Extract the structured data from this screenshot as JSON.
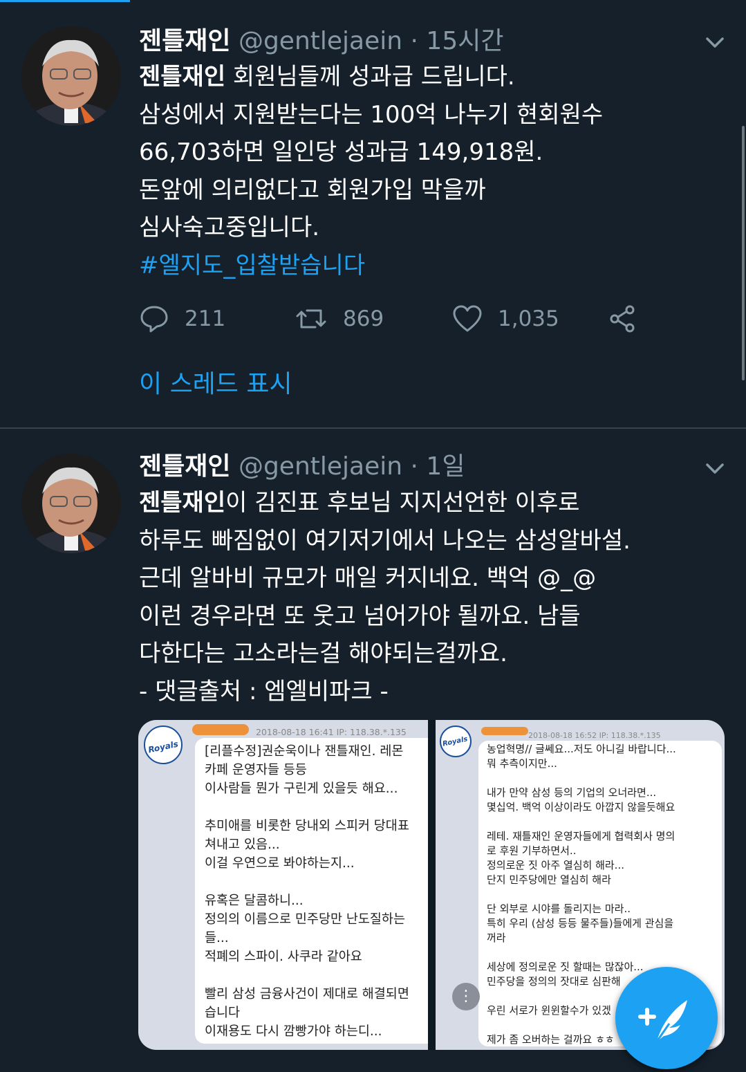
{
  "colors": {
    "background": "#15202b",
    "accent": "#1da1f2",
    "secondary_text": "#8899a6",
    "divider": "#38444d"
  },
  "tweets": [
    {
      "name": "젠틀재인",
      "handle": "@gentlejaein",
      "separator": "·",
      "time": "15시간",
      "lines": [
        {
          "bold": "젠틀재인",
          "rest": " 회원님들께 성과급 드립니다."
        },
        {
          "bold": "",
          "rest": "삼성에서 지원받는다는 100억 나누기 현회원수"
        },
        {
          "bold": "",
          "rest": "66,703하면 일인당 성과급 149,918원."
        },
        {
          "bold": "",
          "rest": "돈앞에 의리없다고 회원가입 막을까"
        },
        {
          "bold": "",
          "rest": "심사숙고중입니다."
        }
      ],
      "hashtag": "#엘지도_입찰받습니다",
      "actions": {
        "replies": "211",
        "retweets": "869",
        "likes": "1,035"
      },
      "thread_link": "이 스레드 표시"
    },
    {
      "name": "젠틀재인",
      "handle": "@gentlejaein",
      "separator": "·",
      "time": "1일",
      "lines": [
        {
          "bold": "젠틀재인",
          "rest": "이 김진표 후보님 지지선언한 이후로"
        },
        {
          "bold": "",
          "rest": "하루도 빠짐없이 여기저기에서 나오는 삼성알바설."
        },
        {
          "bold": "",
          "rest": "근데 알바비 규모가 매일 커지네요. 백억 @_@"
        },
        {
          "bold": "",
          "rest": "이런 경우라면 또 웃고 넘어가야 될까요. 남들"
        },
        {
          "bold": "",
          "rest": "다한다는 고소라는걸 해야되는걸까요."
        },
        {
          "bold": "",
          "rest": "- 댓글출처 : 엠엘비파크 -"
        }
      ],
      "media": {
        "left": {
          "logo_text": "Royals",
          "meta": "2018-08-18 16:41  IP: 118.38.*.135",
          "lines": [
            "[리플수정]권순욱이나 잰틀재인. 레몬",
            "카페 운영자들 등등",
            "이사람들 뭔가 구린게 있을듯 해요...",
            "",
            "추미애를 비롯한 당내외 스피커 당대표",
            "쳐내고 있음...",
            "이걸 우연으로 봐야하는지...",
            "",
            "유혹은 달콤하니...",
            "정의의 이름으로 민주당만 난도질하는",
            "들...",
            "적폐의 스파이. 사쿠라 같아요",
            "",
            "빨리 삼성 금융사건이 제대로 해결되면",
            "습니다",
            "이재용도 다시 깜빵가야 하는디..."
          ]
        },
        "right": {
          "logo_text": "Royals",
          "meta": "2018-08-18 16:52  IP: 118.38.*.135",
          "lines": [
            "농업혁명// 글쎄요...저도 아니길 바랍니다...",
            "뭐 추측이지만...",
            "",
            "내가 만약 삼성 등의 기업의 오너라면...",
            "몇십억. 백억 이상이라도 아깝지 않을듯해요",
            "",
            "레테. 재틀재인 운영자들에게 협력회사 명의",
            "로 후원 기부하면서..",
            "정의로운 짓 아주 열심히 해라...",
            "단지 민주당에만 열심히 해라",
            "",
            "단 외부로 시야를 돌리지는 마라..",
            "특히 우리 (삼성 등등 물주들)들에게 관심을",
            "꺼라",
            "",
            "세상에 정의로운 짓 할때는 많잖아...",
            "민주당을 정의의 잣대로 심판해",
            "",
            "우린 서로가 윈윈할수가 있겠",
            "",
            "제가 좀 오버하는 걸까요 ㅎㅎ"
          ]
        }
      }
    }
  ]
}
